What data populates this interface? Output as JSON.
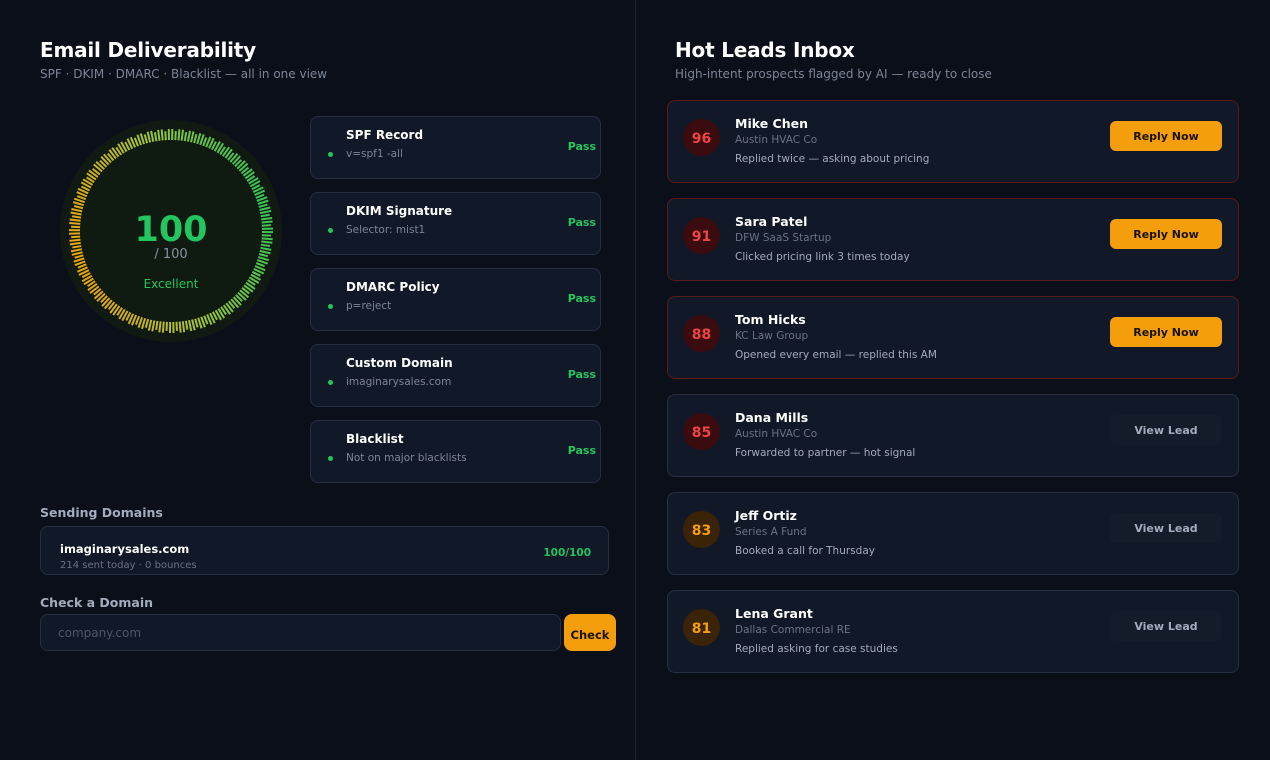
{
  "deliverability": {
    "title": "Email Deliverability",
    "subtitle": "SPF · DKIM · DMARC · Blacklist — all in one view",
    "score": "100",
    "score_max": "/ 100",
    "score_fraction": 1.0,
    "score_label": "Excellent",
    "checks": [
      {
        "name": "SPF Record",
        "value": "v=spf1 -all",
        "status": "Pass"
      },
      {
        "name": "DKIM Signature",
        "value": "Selector: mist1",
        "status": "Pass"
      },
      {
        "name": "DMARC Policy",
        "value": "p=reject",
        "status": "Pass"
      },
      {
        "name": "Custom Domain",
        "value": "imaginarysales.com",
        "status": "Pass"
      },
      {
        "name": "Blacklist",
        "value": "Not on major blacklists",
        "status": "Pass"
      }
    ]
  },
  "sending_domains": {
    "label": "Sending Domains",
    "items": [
      {
        "domain": "imaginarysales.com",
        "meta": "214 sent today · 0 bounces",
        "score": "100/100"
      }
    ]
  },
  "check_domain": {
    "label": "Check a Domain",
    "placeholder": "company.com",
    "button": "Check"
  },
  "leads": {
    "title": "Hot Leads Inbox",
    "subtitle": "High-intent prospects flagged by AI — ready to close",
    "items": [
      {
        "score": "96",
        "name": "Mike Chen",
        "company": "Austin HVAC Co",
        "note": "Replied twice — asking about pricing",
        "action": "Reply Now"
      },
      {
        "score": "91",
        "name": "Sara Patel",
        "company": "DFW SaaS Startup",
        "note": "Clicked pricing link 3 times today",
        "action": "Reply Now"
      },
      {
        "score": "88",
        "name": "Tom Hicks",
        "company": "KC Law Group",
        "note": "Opened every email — replied this AM",
        "action": "Reply Now"
      },
      {
        "score": "85",
        "name": "Dana Mills",
        "company": "Austin HVAC Co",
        "note": "Forwarded to partner — hot signal",
        "action": "View Lead"
      },
      {
        "score": "83",
        "name": "Jeff Ortiz",
        "company": "Series A Fund",
        "note": "Booked a call for Thursday",
        "action": "View Lead"
      },
      {
        "score": "81",
        "name": "Lena Grant",
        "company": "Dallas Commercial RE",
        "note": "Replied asking for case studies",
        "action": "View Lead"
      }
    ]
  },
  "colors": {
    "background": "#0a0f1a",
    "card": "#111827",
    "pass": "#22c55e",
    "accent": "#f59e0b",
    "hot": "#ef4444"
  }
}
